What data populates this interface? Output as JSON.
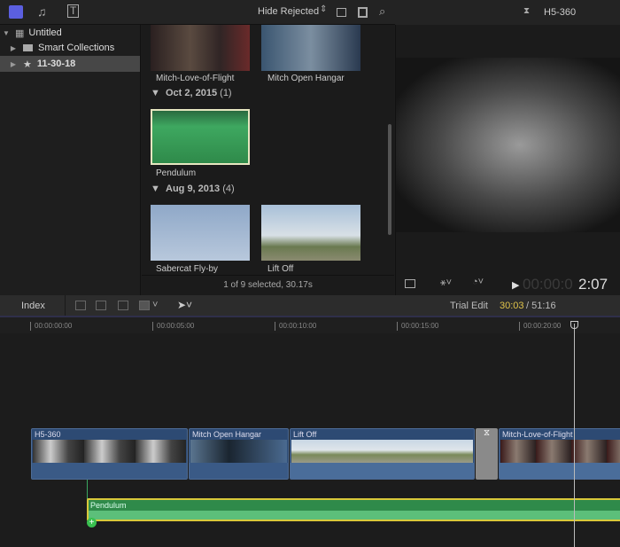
{
  "toolbar": {
    "filter": "Hide Rejected",
    "icons": [
      "libraries-icon",
      "photos-audio-icon",
      "titles-generators-icon",
      "clip-appearance-icon",
      "filmstrip-icon",
      "search-icon"
    ]
  },
  "sidebar": {
    "items": [
      {
        "label": "Untitled"
      },
      {
        "label": "Smart Collections"
      },
      {
        "label": "11-30-18"
      }
    ]
  },
  "browser": {
    "top_clips": [
      {
        "label": "Mitch-Love-of-Flight"
      },
      {
        "label": "Mitch Open Hangar"
      }
    ],
    "groups": [
      {
        "date": "Oct 2, 2015",
        "count": "(1)",
        "clips": [
          {
            "label": "Pendulum"
          }
        ]
      },
      {
        "date": "Aug 9, 2013",
        "count": "(4)",
        "clips": [
          {
            "label": "Sabercat Fly-by"
          },
          {
            "label": "Lift Off"
          }
        ]
      }
    ],
    "status": "1 of 9 selected, 30.17s"
  },
  "viewer": {
    "title": "H5-360",
    "timecode_dim": "00:00:0",
    "timecode": "2:07"
  },
  "timeline": {
    "index": "Index",
    "mode": "Trial Edit",
    "position": "30:03",
    "duration": "/ 51:16",
    "ruler": [
      "00:00:00:00",
      "00:00:05:00",
      "00:00:10:00",
      "00:00:15:00",
      "00:00:20:00"
    ],
    "clips": [
      "H5-360",
      "Mitch Open Hangar",
      "Lift Off",
      "Mitch-Love-of-Flight"
    ],
    "audio_clip": "Pendulum"
  },
  "colors": {
    "accent": "#e0c34a",
    "video_clip": "#2d4a73",
    "audio_clip": "#2f8a4a"
  }
}
